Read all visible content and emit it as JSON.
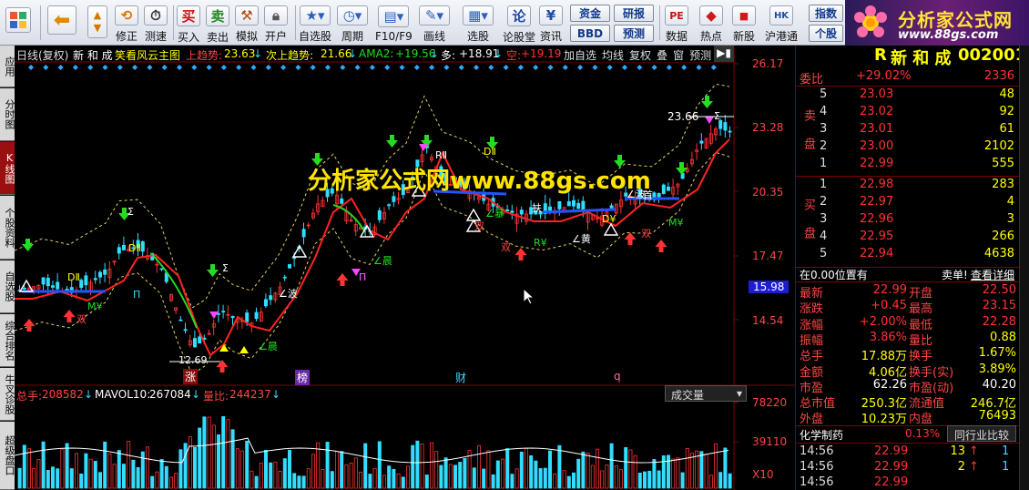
{
  "toolbar": {
    "buttons": [
      {
        "label": "",
        "icon": "grid-icon"
      },
      {
        "label": "",
        "icon": "back-arrow-icon"
      },
      {
        "label": "",
        "icon": "up-down-arrows-icon"
      },
      {
        "label": "修正",
        "icon": "clock-refresh-icon"
      },
      {
        "label": "测速",
        "icon": "stopwatch-icon"
      },
      {
        "label": "买入",
        "icon": "buy-icon",
        "glyph": "买"
      },
      {
        "label": "卖出",
        "icon": "sell-icon",
        "glyph": "卖"
      },
      {
        "label": "模拟",
        "icon": "hammer-icon"
      },
      {
        "label": "开户",
        "icon": "lock-icon"
      },
      {
        "label": "自选股",
        "icon": "star-icon"
      },
      {
        "label": "周期",
        "icon": "clock-icon"
      },
      {
        "label": "F10/F9",
        "icon": "chart-doc-icon"
      },
      {
        "label": "画线",
        "icon": "pen-icon"
      },
      {
        "label": "选股",
        "icon": "screen-icon"
      },
      {
        "label": "论股堂",
        "icon": "forum-icon",
        "glyph": "论"
      },
      {
        "label": "资讯",
        "icon": "news-icon"
      },
      {
        "label": "数据",
        "icon": "pe-icon",
        "glyph": "PE"
      },
      {
        "label": "热点",
        "icon": "hot-icon"
      },
      {
        "label": "新股",
        "icon": "new-stock-icon"
      },
      {
        "label": "沪港通",
        "icon": "hk-icon"
      }
    ],
    "small_buttons": [
      "资金",
      "研报",
      "BBD",
      "预测",
      "指数",
      "个股"
    ]
  },
  "logo": {
    "title": "分析家公式网",
    "url": "www.88gs.com"
  },
  "left_tabs": [
    "应用",
    "分时图",
    "K线图",
    "个股资料",
    "自选股",
    "综合排名",
    "牛叉诊股",
    "超级盘口"
  ],
  "chart": {
    "header": {
      "period": "日线(复权)",
      "name": "新 和 成",
      "indicator": "笑看风云主图",
      "up_trend_label": "上趋势:",
      "up_trend_value": "23.63",
      "next_trend_label": "次上趋势:",
      "next_trend_value": "21.66",
      "ama_label": "AMA2:",
      "ama_value": "+19.56",
      "duo_label": "多:",
      "duo_value": "+18.91",
      "kong_label": "空:",
      "kong_value": "+19.19"
    },
    "header_buttons": [
      "加自选",
      "均线",
      "复权",
      "叠",
      "窗",
      "预测"
    ],
    "watermark": "分析家公式网www.88gs.com",
    "price_axis": [
      "26.17",
      "23.28",
      "20.35",
      "17.47",
      "14.54"
    ],
    "current_price_tag": "15.98",
    "peak_label": "23.66",
    "low_label": "12.69",
    "event_markers": [
      "涨",
      "榜",
      "财",
      "q"
    ],
    "volume_header": {
      "total_label": "总手:",
      "total_value": "208582",
      "mavol_label": "MAVOL10:",
      "mavol_value": "267084",
      "ratio_label": "量比:",
      "ratio_value": "244237"
    },
    "volume_dropdown": "成交量",
    "volume_axis": [
      "78220",
      "39110",
      "X10"
    ],
    "signal_labels": [
      "DⅡ",
      "DⅡ",
      "D¥",
      "R¥",
      "RⅡ",
      "DⅡ",
      "∠晨",
      "∠晨",
      "∠波",
      "∠波",
      "∠暴",
      "∠黄",
      "双",
      "双",
      "双",
      "双",
      "扶",
      "首",
      "M¥",
      "M¥",
      "Σ",
      "Σ",
      "Σ",
      "П",
      "П"
    ]
  },
  "quote": {
    "name": "新 和 成",
    "code": "002001",
    "code_prefix": "R",
    "weibi_label": "委比",
    "weibi_pct": "+29.02%",
    "weibi_diff": "2336",
    "sell_side_label": "卖盘",
    "buy_side_label": "买盘",
    "asks": [
      {
        "level": "5",
        "price": "23.03",
        "vol": "48"
      },
      {
        "level": "4",
        "price": "23.02",
        "vol": "92"
      },
      {
        "level": "3",
        "price": "23.01",
        "vol": "61"
      },
      {
        "level": "2",
        "price": "23.00",
        "vol": "2102"
      },
      {
        "level": "1",
        "price": "22.99",
        "vol": "555"
      }
    ],
    "bids": [
      {
        "level": "1",
        "price": "22.98",
        "vol": "283"
      },
      {
        "level": "2",
        "price": "22.97",
        "vol": "4"
      },
      {
        "level": "3",
        "price": "22.96",
        "vol": "3"
      },
      {
        "level": "4",
        "price": "22.95",
        "vol": "266"
      },
      {
        "level": "5",
        "price": "22.94",
        "vol": "4638"
      }
    ],
    "position_label": "在0.00位置有",
    "sell_one_label": "卖单!",
    "detail_label": "查看详细",
    "stats": [
      {
        "l1": "最新",
        "v1": "22.99",
        "l2": "开盘",
        "v2": "22.50"
      },
      {
        "l1": "涨跌",
        "v1": "+0.45",
        "l2": "最高",
        "v2": "23.15"
      },
      {
        "l1": "涨幅",
        "v1": "+2.00%",
        "l2": "最低",
        "v2": "22.28"
      },
      {
        "l1": "振幅",
        "v1": "3.86%",
        "l2": "量比",
        "v2": "0.88"
      },
      {
        "l1": "总手",
        "v1": "17.88万",
        "l2": "换手",
        "v2": "1.67%"
      },
      {
        "l1": "金额",
        "v1": "4.06亿",
        "l2": "换手(实)",
        "v2": "3.89%"
      },
      {
        "l1": "市盈",
        "v1": "62.26",
        "l2": "市盈(动)",
        "v2": "40.20"
      },
      {
        "l1": "总市值",
        "v1": "250.3亿",
        "l2": "流通值",
        "v2": "246.7亿"
      },
      {
        "l1": "外盘",
        "v1": "10.23万",
        "l2": "内盘",
        "v2": "76493"
      }
    ],
    "industry_label": "化学制药",
    "industry_pct": "0.13%",
    "compare_label": "同行业比较",
    "ticks": [
      {
        "time": "14:56",
        "price": "22.99",
        "vol": "13",
        "dir": "up",
        "n": "1"
      },
      {
        "time": "14:56",
        "price": "22.99",
        "vol": "2",
        "dir": "up",
        "n": "1"
      },
      {
        "time": "14:56",
        "price": "22.99",
        "vol": "",
        "dir": "",
        "n": ""
      }
    ],
    "colors": {
      "up": "#ff3333",
      "down": "#22dd22",
      "neutral": "#ffffff",
      "label": "#ff4444",
      "vol": "#33ddff",
      "gold": "#ffff00"
    }
  }
}
